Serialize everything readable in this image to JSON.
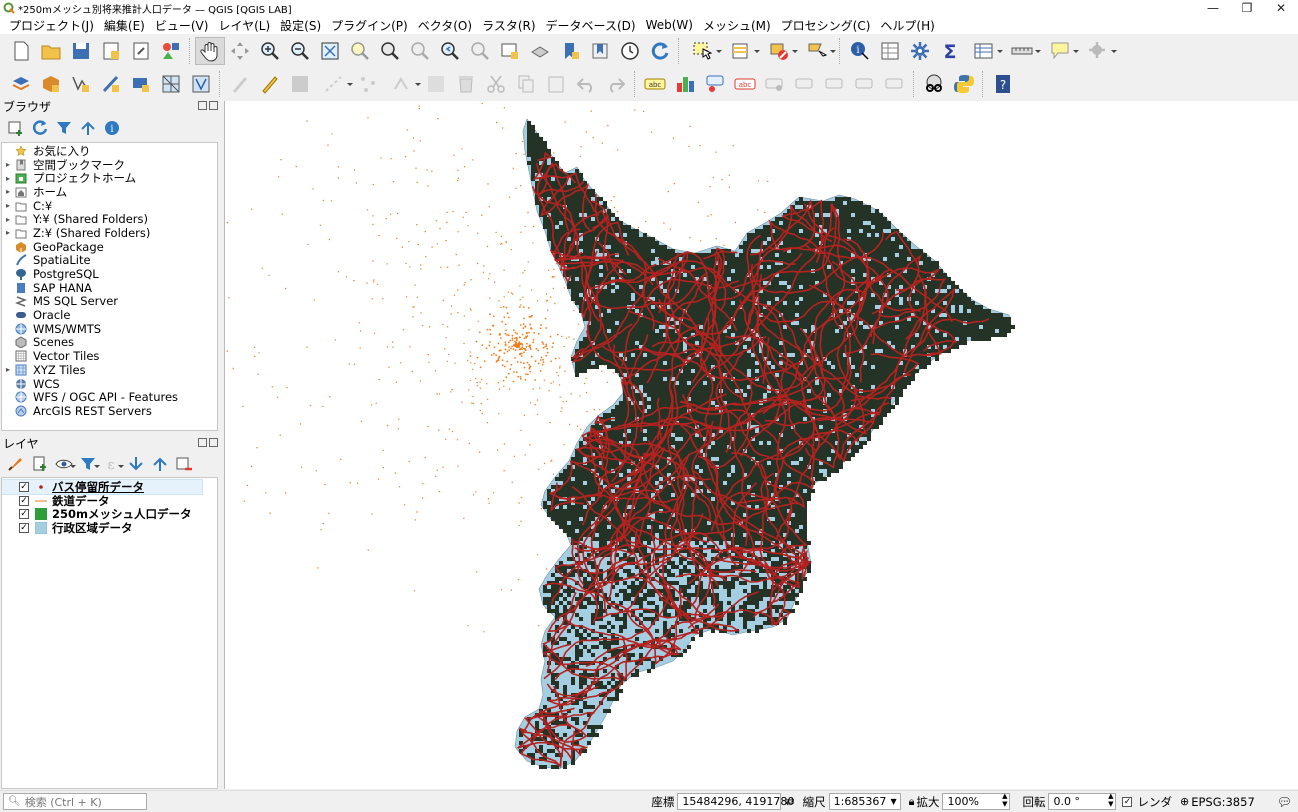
{
  "window": {
    "title": "*250mメッシュ別将来推計人口データ — QGIS [QGIS LAB]",
    "min": "—",
    "max": "❐",
    "close": "✕"
  },
  "menu": [
    "プロジェクト(J)",
    "編集(E)",
    "ビュー(V)",
    "レイヤ(L)",
    "設定(S)",
    "プラグイン(P)",
    "ベクタ(O)",
    "ラスタ(R)",
    "データベース(D)",
    "Web(W)",
    "メッシュ(M)",
    "プロセシング(C)",
    "ヘルプ(H)"
  ],
  "browser": {
    "title": "ブラウザ",
    "items": [
      {
        "label": "お気に入り",
        "icon": "star-icon",
        "expand": ""
      },
      {
        "label": "空間ブックマーク",
        "icon": "bookmark-icon",
        "expand": "▸"
      },
      {
        "label": "プロジェクトホーム",
        "icon": "project-home-icon",
        "expand": "▸"
      },
      {
        "label": "ホーム",
        "icon": "home-folder-icon",
        "expand": "▸"
      },
      {
        "label": "C:¥",
        "icon": "folder-icon",
        "expand": "▸"
      },
      {
        "label": "Y:¥ (Shared Folders)",
        "icon": "folder-icon",
        "expand": "▸"
      },
      {
        "label": "Z:¥ (Shared Folders)",
        "icon": "folder-icon",
        "expand": "▸"
      },
      {
        "label": "GeoPackage",
        "icon": "geopackage-icon",
        "expand": ""
      },
      {
        "label": "SpatiaLite",
        "icon": "spatialite-icon",
        "expand": ""
      },
      {
        "label": "PostgreSQL",
        "icon": "postgresql-icon",
        "expand": ""
      },
      {
        "label": "SAP HANA",
        "icon": "saphana-icon",
        "expand": ""
      },
      {
        "label": "MS SQL Server",
        "icon": "mssql-icon",
        "expand": ""
      },
      {
        "label": "Oracle",
        "icon": "oracle-icon",
        "expand": ""
      },
      {
        "label": "WMS/WMTS",
        "icon": "wms-icon",
        "expand": ""
      },
      {
        "label": "Scenes",
        "icon": "scenes-icon",
        "expand": ""
      },
      {
        "label": "Vector Tiles",
        "icon": "vector-tiles-icon",
        "expand": ""
      },
      {
        "label": "XYZ Tiles",
        "icon": "xyz-tiles-icon",
        "expand": "▸"
      },
      {
        "label": "WCS",
        "icon": "wcs-icon",
        "expand": ""
      },
      {
        "label": "WFS / OGC API - Features",
        "icon": "wfs-icon",
        "expand": ""
      },
      {
        "label": "ArcGIS REST Servers",
        "icon": "arcgis-icon",
        "expand": ""
      }
    ]
  },
  "layers": {
    "title": "レイヤ",
    "items": [
      {
        "label": "バス停留所データ",
        "checked": "✓",
        "symbol": "point"
      },
      {
        "label": "鉄道データ",
        "checked": "✓",
        "symbol": "line"
      },
      {
        "label": "250mメッシュ人口データ",
        "checked": "✓",
        "symbol": "green"
      },
      {
        "label": "行政区域データ",
        "checked": "✓",
        "symbol": "blue"
      }
    ]
  },
  "colors": {
    "admin_fill": "#a6cee3",
    "mesh_fill": "#243325",
    "rail": "#b5221f",
    "bus_stop": "#f07d1a"
  },
  "status": {
    "search_placeholder": "検索 (Ctrl + K)",
    "coord_label": "座標",
    "coord_value": "15484296, 4191780",
    "scale_label": "縮尺",
    "scale_value": "1:685367",
    "magnify_label": "拡大",
    "magnify_value": "100%",
    "rotation_label": "回転",
    "rotation_value": "0.0 °",
    "render_label": "レンダ",
    "render_checked": "✓",
    "crs": "EPSG:3857"
  }
}
